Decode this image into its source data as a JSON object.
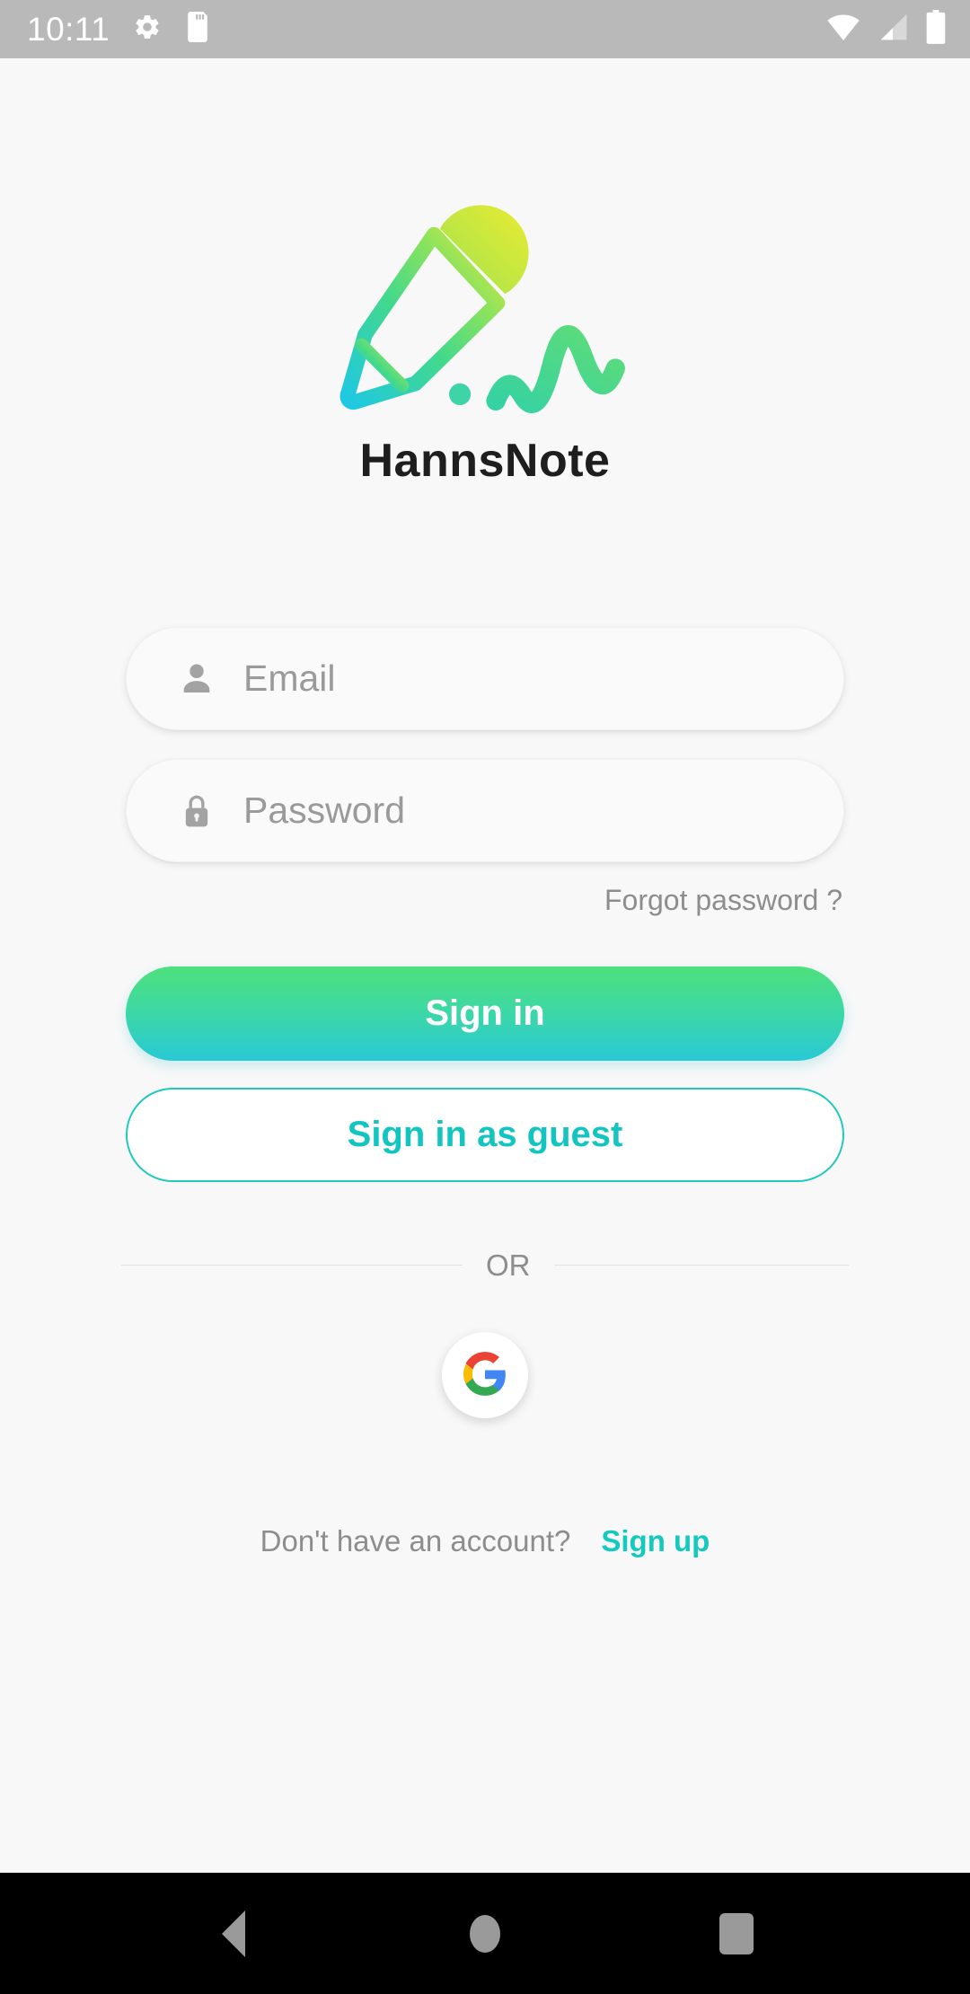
{
  "status_bar": {
    "time": "10:11",
    "icons": [
      "settings-gear-icon",
      "sd-card-icon",
      "wifi-icon",
      "cellular-signal-icon",
      "battery-icon"
    ],
    "background_color": "#b9b9b9",
    "foreground_color": "#ffffff"
  },
  "brand": {
    "logo_icon": "pencil-writing-logo",
    "app_name": "HannsNote",
    "logo_gradient_start": "#1fc8e3",
    "logo_gradient_mid": "#43d98a",
    "logo_gradient_end": "#e3e93a"
  },
  "form": {
    "email": {
      "icon": "person-icon",
      "placeholder": "Email",
      "value": ""
    },
    "password": {
      "icon": "lock-icon",
      "placeholder": "Password",
      "value": ""
    },
    "forgot_password_label": "Forgot password ?"
  },
  "actions": {
    "sign_in_label": "Sign in",
    "sign_in_guest_label": "Sign in as guest",
    "divider_label": "OR",
    "google_icon": "google-g-icon"
  },
  "footer": {
    "prompt": "Don't have an account?",
    "sign_up_label": "Sign up"
  },
  "theme": {
    "page_background": "#f8f8f9",
    "primary_gradient_from": "#4ee07c",
    "primary_gradient_to": "#28c9d6",
    "accent_teal": "#14cabf",
    "muted_text": "#8d8d8d",
    "placeholder_text": "#9a9a9a"
  },
  "nav_bar": {
    "items": [
      "back-button",
      "home-button",
      "recents-button"
    ],
    "background_color": "#000000"
  }
}
